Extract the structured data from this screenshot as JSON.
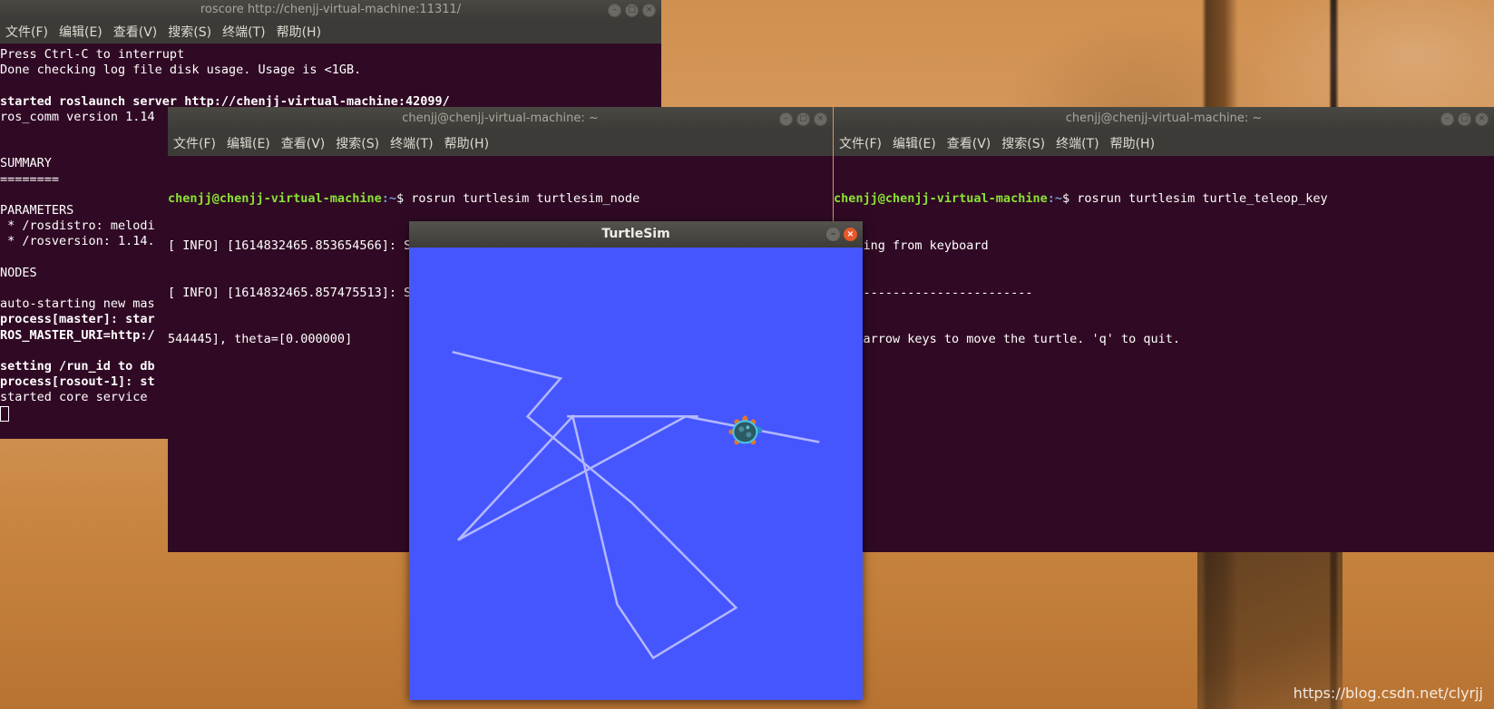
{
  "desktop": {
    "watermark": "https://blog.csdn.net/clyrjj"
  },
  "menu": [
    "文件(F)",
    "编辑(E)",
    "查看(V)",
    "搜索(S)",
    "终端(T)",
    "帮助(H)"
  ],
  "roscore_window": {
    "title": "roscore http://chenjj-virtual-machine:11311/",
    "lines": [
      {
        "text": "Press Ctrl-C to interrupt",
        "bold": false
      },
      {
        "text": "Done checking log file disk usage. Usage is <1GB.",
        "bold": false
      },
      {
        "text": "",
        "bold": false
      },
      {
        "text": "started roslaunch server http://chenjj-virtual-machine:42099/",
        "bold": true
      },
      {
        "text": "ros_comm version 1.14",
        "bold": false
      },
      {
        "text": "",
        "bold": false
      },
      {
        "text": "",
        "bold": false
      },
      {
        "text": "SUMMARY",
        "bold": false
      },
      {
        "text": "========",
        "bold": false
      },
      {
        "text": "",
        "bold": false
      },
      {
        "text": "PARAMETERS",
        "bold": false
      },
      {
        "text": " * /rosdistro: melodi",
        "bold": false
      },
      {
        "text": " * /rosversion: 1.14.",
        "bold": false
      },
      {
        "text": "",
        "bold": false
      },
      {
        "text": "NODES",
        "bold": false
      },
      {
        "text": "",
        "bold": false
      },
      {
        "text": "auto-starting new mas",
        "bold": false
      },
      {
        "text": "process[master]: star",
        "bold": true
      },
      {
        "text": "ROS_MASTER_URI=http:/",
        "bold": true
      },
      {
        "text": "",
        "bold": false
      },
      {
        "text": "setting /run_id to db",
        "bold": true
      },
      {
        "text": "process[rosout-1]: st",
        "bold": true
      },
      {
        "text": "started core service",
        "bold": false
      }
    ]
  },
  "node_window": {
    "title": "chenjj@chenjj-virtual-machine: ~",
    "prompt_user": "chenjj@chenjj-virtual-machine",
    "prompt_path": ":~",
    "prompt_symbol": "$ ",
    "command": "rosrun turtlesim turtlesim_node",
    "output": [
      "[ INFO] [1614832465.853654566]: Starting turtlesim with node name /turtlesim",
      "[ INFO] [1614832465.857475513]: Spawning turtle [turtle1] at x=[5.544445], y=[5.",
      "544445], theta=[0.000000]"
    ]
  },
  "teleop_window": {
    "title": "chenjj@chenjj-virtual-machine: ~",
    "prompt_user": "chenjj@chenjj-virtual-machine",
    "prompt_path": ":~",
    "prompt_symbol": "$ ",
    "command": "rosrun turtlesim turtle_teleop_key",
    "output": [
      "Reading from keyboard",
      "---------------------------",
      "Use arrow keys to move the turtle. 'q' to quit."
    ]
  },
  "turtlesim": {
    "title": "TurtleSim",
    "background_color": "#4556ff",
    "path_color": "#b3b8ff",
    "turtle_icon": "turtle-icon",
    "path_points_world": [
      [
        10.05,
        6.32
      ],
      [
        6.78,
        6.95
      ],
      [
        1.2,
        3.92
      ],
      [
        4.01,
        6.95
      ],
      [
        5.1,
        2.34
      ],
      [
        5.98,
        1.03
      ],
      [
        8.01,
        2.26
      ],
      [
        5.46,
        4.83
      ],
      [
        2.9,
        6.95
      ],
      [
        3.71,
        7.88
      ],
      [
        1.06,
        8.53
      ]
    ],
    "extra_segments_world": [
      [
        [
          3.87,
          6.95
        ],
        [
          7.08,
          6.95
        ]
      ]
    ],
    "turtle_position": {
      "x": 8.23,
      "y": 6.57
    }
  }
}
